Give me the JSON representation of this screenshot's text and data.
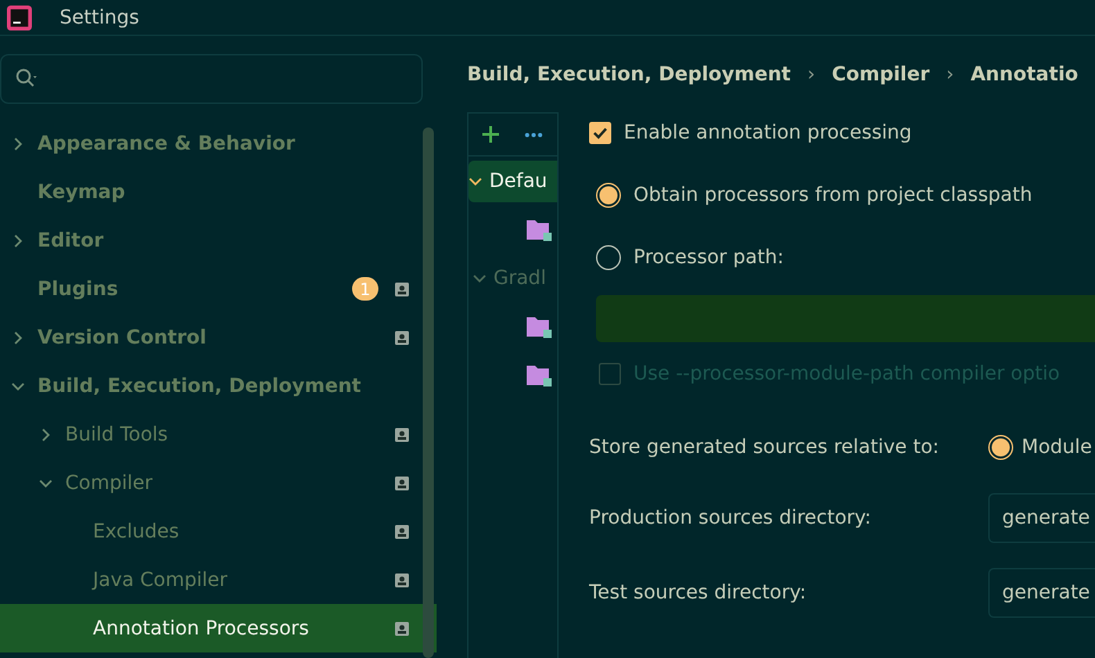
{
  "window": {
    "title": "Settings"
  },
  "sidebar": {
    "items": [
      {
        "label": "Appearance & Behavior",
        "expanded": false,
        "selected": false,
        "project_icon": false
      },
      {
        "label": "Keymap",
        "selected": false,
        "project_icon": false
      },
      {
        "label": "Editor",
        "expanded": false,
        "selected": false,
        "project_icon": false
      },
      {
        "label": "Plugins",
        "selected": false,
        "project_icon": true,
        "badge": "1"
      },
      {
        "label": "Version Control",
        "expanded": false,
        "selected": false,
        "project_icon": true
      },
      {
        "label": "Build, Execution, Deployment",
        "expanded": true,
        "selected": false,
        "project_icon": false,
        "children": [
          {
            "label": "Build Tools",
            "expanded": false,
            "selected": false,
            "project_icon": true
          },
          {
            "label": "Compiler",
            "expanded": true,
            "selected": false,
            "project_icon": true,
            "children": [
              {
                "label": "Excludes",
                "selected": false,
                "project_icon": true
              },
              {
                "label": "Java Compiler",
                "selected": false,
                "project_icon": true
              },
              {
                "label": "Annotation Processors",
                "selected": true,
                "project_icon": true
              }
            ]
          }
        ]
      }
    ]
  },
  "breadcrumb": {
    "separator": "›",
    "items": [
      "Build, Execution, Deployment",
      "Compiler",
      "Annotatio"
    ]
  },
  "profiles": {
    "items": [
      {
        "label": "Defau",
        "expanded": true,
        "selected": true,
        "modules": [
          {
            "kind": "module"
          }
        ]
      },
      {
        "label": "Gradl",
        "expanded": true,
        "selected": false,
        "modules": [
          {
            "kind": "module"
          },
          {
            "kind": "module"
          }
        ]
      }
    ]
  },
  "options": {
    "enable": {
      "label": "Enable annotation processing",
      "checked": true
    },
    "sources": [
      {
        "label": "Obtain processors from project classpath",
        "selected": true
      },
      {
        "label": "Processor path:",
        "selected": false
      }
    ],
    "module_path": {
      "label": "Use --processor-module-path compiler optio",
      "checked": false,
      "disabled": true
    },
    "store": {
      "label": "Store generated sources relative to:",
      "option": "Module",
      "selected": true
    },
    "dirs": [
      {
        "label": "Production sources directory:",
        "value": "generate"
      },
      {
        "label": "Test sources directory:",
        "value": "generate"
      }
    ]
  }
}
